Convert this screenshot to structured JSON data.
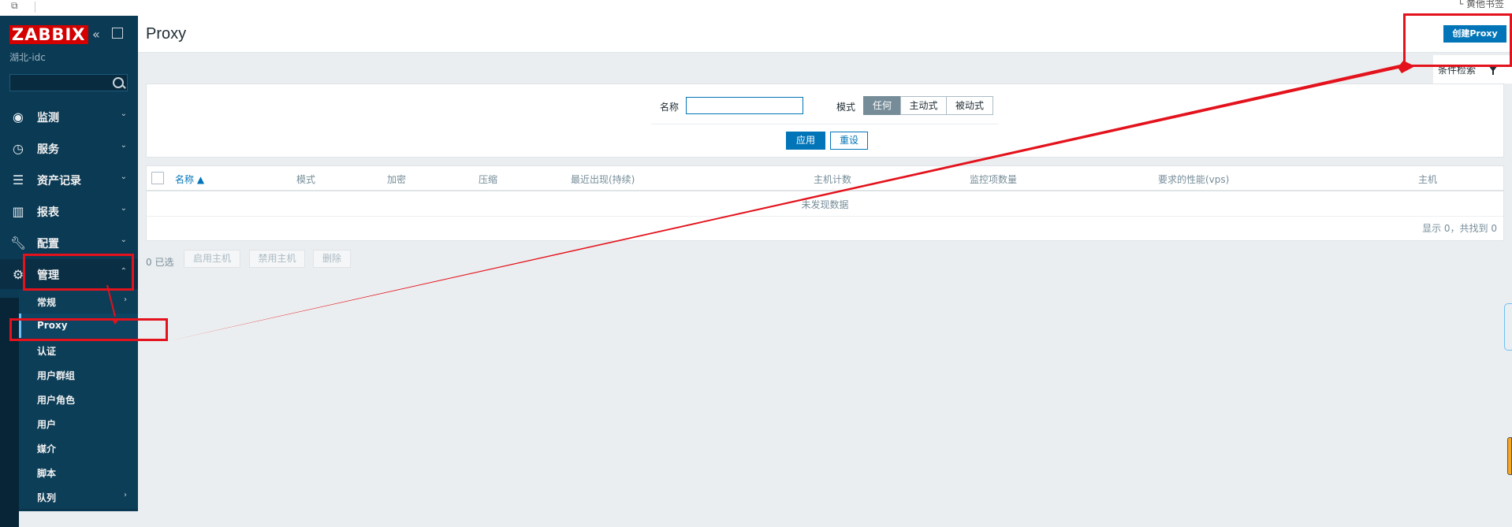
{
  "browser": {
    "right_text": "└ 黄他书签"
  },
  "sidebar": {
    "logo": "ZABBIX",
    "server_name": "湖北-idc",
    "nav": [
      {
        "label": "监测",
        "icon": "eye-icon"
      },
      {
        "label": "服务",
        "icon": "stopwatch-icon"
      },
      {
        "label": "资产记录",
        "icon": "list-icon"
      },
      {
        "label": "报表",
        "icon": "bar-chart-icon"
      },
      {
        "label": "配置",
        "icon": "wrench-icon"
      },
      {
        "label": "管理",
        "icon": "gear-icon"
      }
    ],
    "admin_sub": [
      {
        "label": "常规"
      },
      {
        "label": "Proxy"
      },
      {
        "label": "认证"
      },
      {
        "label": "用户群组"
      },
      {
        "label": "用户角色"
      },
      {
        "label": "用户"
      },
      {
        "label": "媒介"
      },
      {
        "label": "脚本"
      },
      {
        "label": "队列"
      }
    ]
  },
  "header": {
    "title": "Proxy",
    "create_button": "创建Proxy"
  },
  "filter": {
    "tab_label": "条件检索",
    "name_label": "名称",
    "name_value": "",
    "mode_label": "模式",
    "mode_options": [
      "任何",
      "主动式",
      "被动式"
    ],
    "mode_selected": "任何",
    "apply": "应用",
    "reset": "重设"
  },
  "table": {
    "columns": [
      "名称 ▲",
      "模式",
      "加密",
      "压缩",
      "最近出现(持续)",
      "主机计数",
      "监控项数量",
      "要求的性能(vps)",
      "主机"
    ],
    "empty_text": "未发现数据",
    "footer": "显示 0，共找到 0"
  },
  "actions": {
    "selected": "0 已选",
    "buttons": [
      "启用主机",
      "禁用主机",
      "删除"
    ]
  },
  "colors": {
    "accent": "#0275b8",
    "sidebar": "#0b3a54",
    "annotation": "#e3121c"
  }
}
